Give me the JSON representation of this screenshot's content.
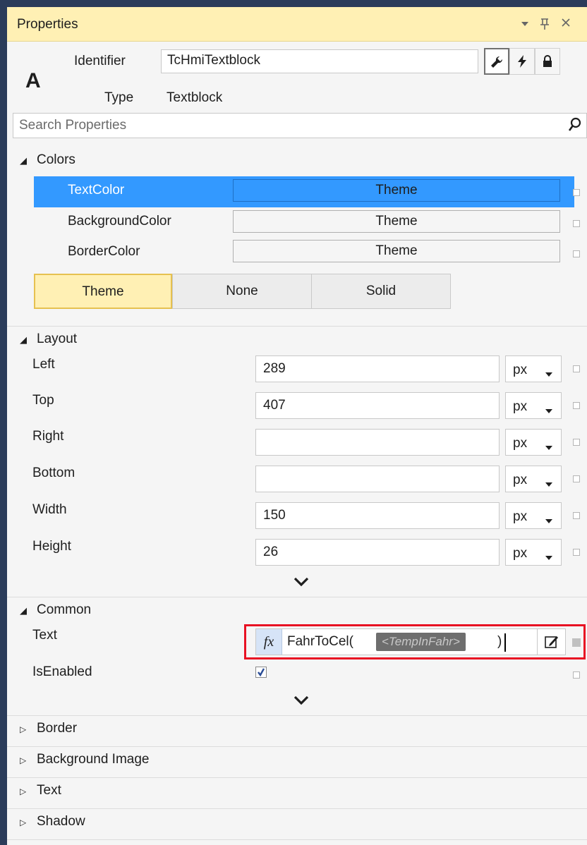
{
  "panel": {
    "title": "Properties"
  },
  "titlebar": {
    "dropdown_glyph": "▾",
    "pin_glyph": "ᛪ",
    "close_glyph": "✕"
  },
  "header": {
    "type_icon": "A",
    "identifier_label": "Identifier",
    "identifier_value": "TcHmiTextblock",
    "type_label": "Type",
    "type_value": "Textblock"
  },
  "search": {
    "placeholder": "Search Properties",
    "value": ""
  },
  "categories": {
    "colors": {
      "label": "Colors",
      "rows": [
        {
          "name": "TextColor",
          "value": "Theme",
          "selected": true
        },
        {
          "name": "BackgroundColor",
          "value": "Theme",
          "selected": false
        },
        {
          "name": "BorderColor",
          "value": "Theme",
          "selected": false
        }
      ],
      "modes": [
        "Theme",
        "None",
        "Solid"
      ],
      "active_mode": "Theme"
    },
    "layout": {
      "label": "Layout",
      "rows": [
        {
          "name": "Left",
          "value": "289",
          "unit": "px"
        },
        {
          "name": "Top",
          "value": "407",
          "unit": "px"
        },
        {
          "name": "Right",
          "value": "",
          "unit": "px"
        },
        {
          "name": "Bottom",
          "value": "",
          "unit": "px"
        },
        {
          "name": "Width",
          "value": "150",
          "unit": "px"
        },
        {
          "name": "Height",
          "value": "26",
          "unit": "px"
        }
      ]
    },
    "common": {
      "label": "Common",
      "text_label": "Text",
      "fx_label": "fx",
      "function_name": "FahrToCel(",
      "param_token": "<TempInFahr>",
      "closing": ")",
      "isenabled_label": "IsEnabled",
      "isenabled_checked": true
    },
    "collapsed": [
      "Border",
      "Background Image",
      "Text",
      "Shadow"
    ]
  },
  "colors": {
    "selection": "#3399ff",
    "title_bg": "#fff0b4",
    "highlight_border": "#e81123"
  }
}
